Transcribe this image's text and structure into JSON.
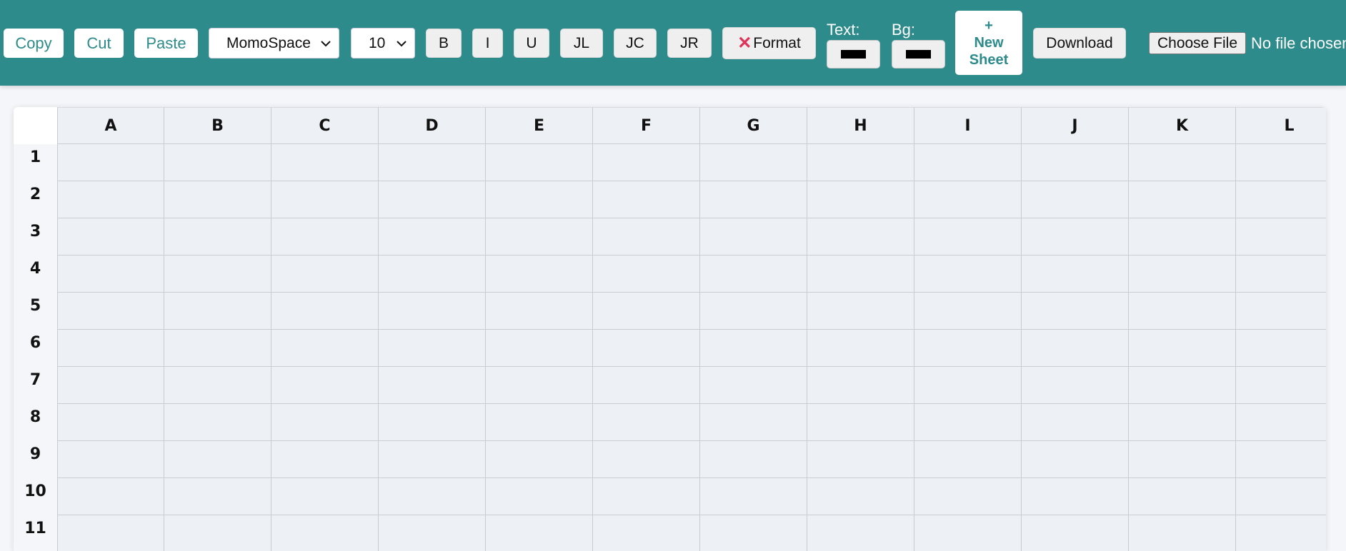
{
  "toolbar": {
    "copy_label": "Copy",
    "cut_label": "Cut",
    "paste_label": "Paste",
    "font_family_value": "MomoSpace",
    "font_size_value": "10",
    "bold_label": "B",
    "italic_label": "I",
    "underline_label": "U",
    "justify_left_label": "JL",
    "justify_center_label": "JC",
    "justify_right_label": "JR",
    "clear_format_label": "Format",
    "clear_format_icon": "x-icon",
    "text_color_label": "Text:",
    "text_color_value": "#000000",
    "bg_color_label": "Bg:",
    "bg_color_value": "#000000",
    "new_sheet_line1": "+",
    "new_sheet_line2": "New",
    "new_sheet_line3": "Sheet",
    "download_label": "Download",
    "choose_file_label": "Choose File",
    "file_status": "No file chosen"
  },
  "colors": {
    "toolbar_bg": "#2d8b8b",
    "accent_text": "#2d8b8b",
    "clear_icon": "#e0335a",
    "cell_bg": "#edf0f4",
    "grid_line": "#c9ccd1"
  },
  "sheet": {
    "columns": [
      "A",
      "B",
      "C",
      "D",
      "E",
      "F",
      "G",
      "H",
      "I",
      "J",
      "K",
      "L"
    ],
    "rows": [
      "1",
      "2",
      "3",
      "4",
      "5",
      "6",
      "7",
      "8",
      "9",
      "10",
      "11"
    ]
  }
}
